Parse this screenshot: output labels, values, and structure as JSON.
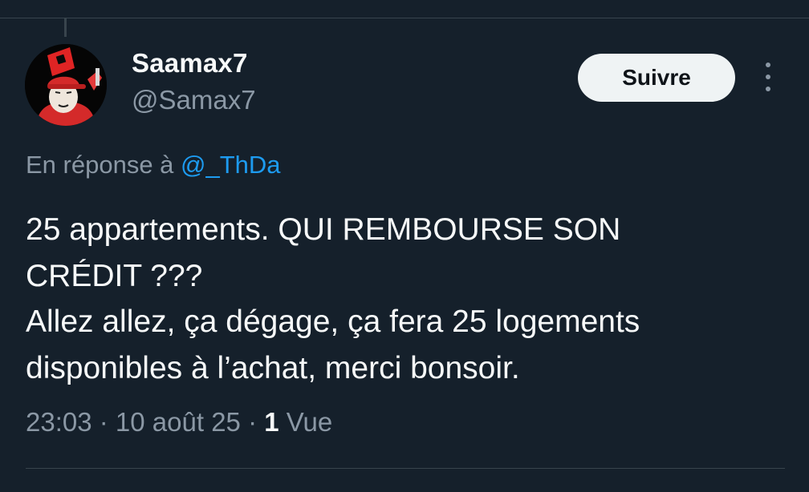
{
  "author": {
    "display_name": "Saamax7",
    "handle": "@Samax7",
    "avatar_icon": "cartoon-avatar-red-cap-icon"
  },
  "follow_button": {
    "label": "Suivre"
  },
  "more_menu_icon": "more-vertical-icon",
  "reply_context": {
    "prefix": "En réponse à ",
    "mention": "@_ThDa"
  },
  "tweet": {
    "lines": [
      "25 appartements. QUI REMBOURSE SON",
      "CRÉDIT ???",
      "Allez allez, ça dégage, ça fera 25 logements",
      "disponibles à l’achat, merci bonsoir."
    ]
  },
  "meta": {
    "time": "23:03",
    "separator": " · ",
    "date": "10 août 25",
    "views_count": "1",
    "views_label": " Vue"
  },
  "colors": {
    "background": "#15202b",
    "text": "#f7f9f9",
    "secondary_text": "#8b98a5",
    "link": "#1d9bf0",
    "divider": "#38444d",
    "follow_button_bg": "#eff3f4"
  }
}
